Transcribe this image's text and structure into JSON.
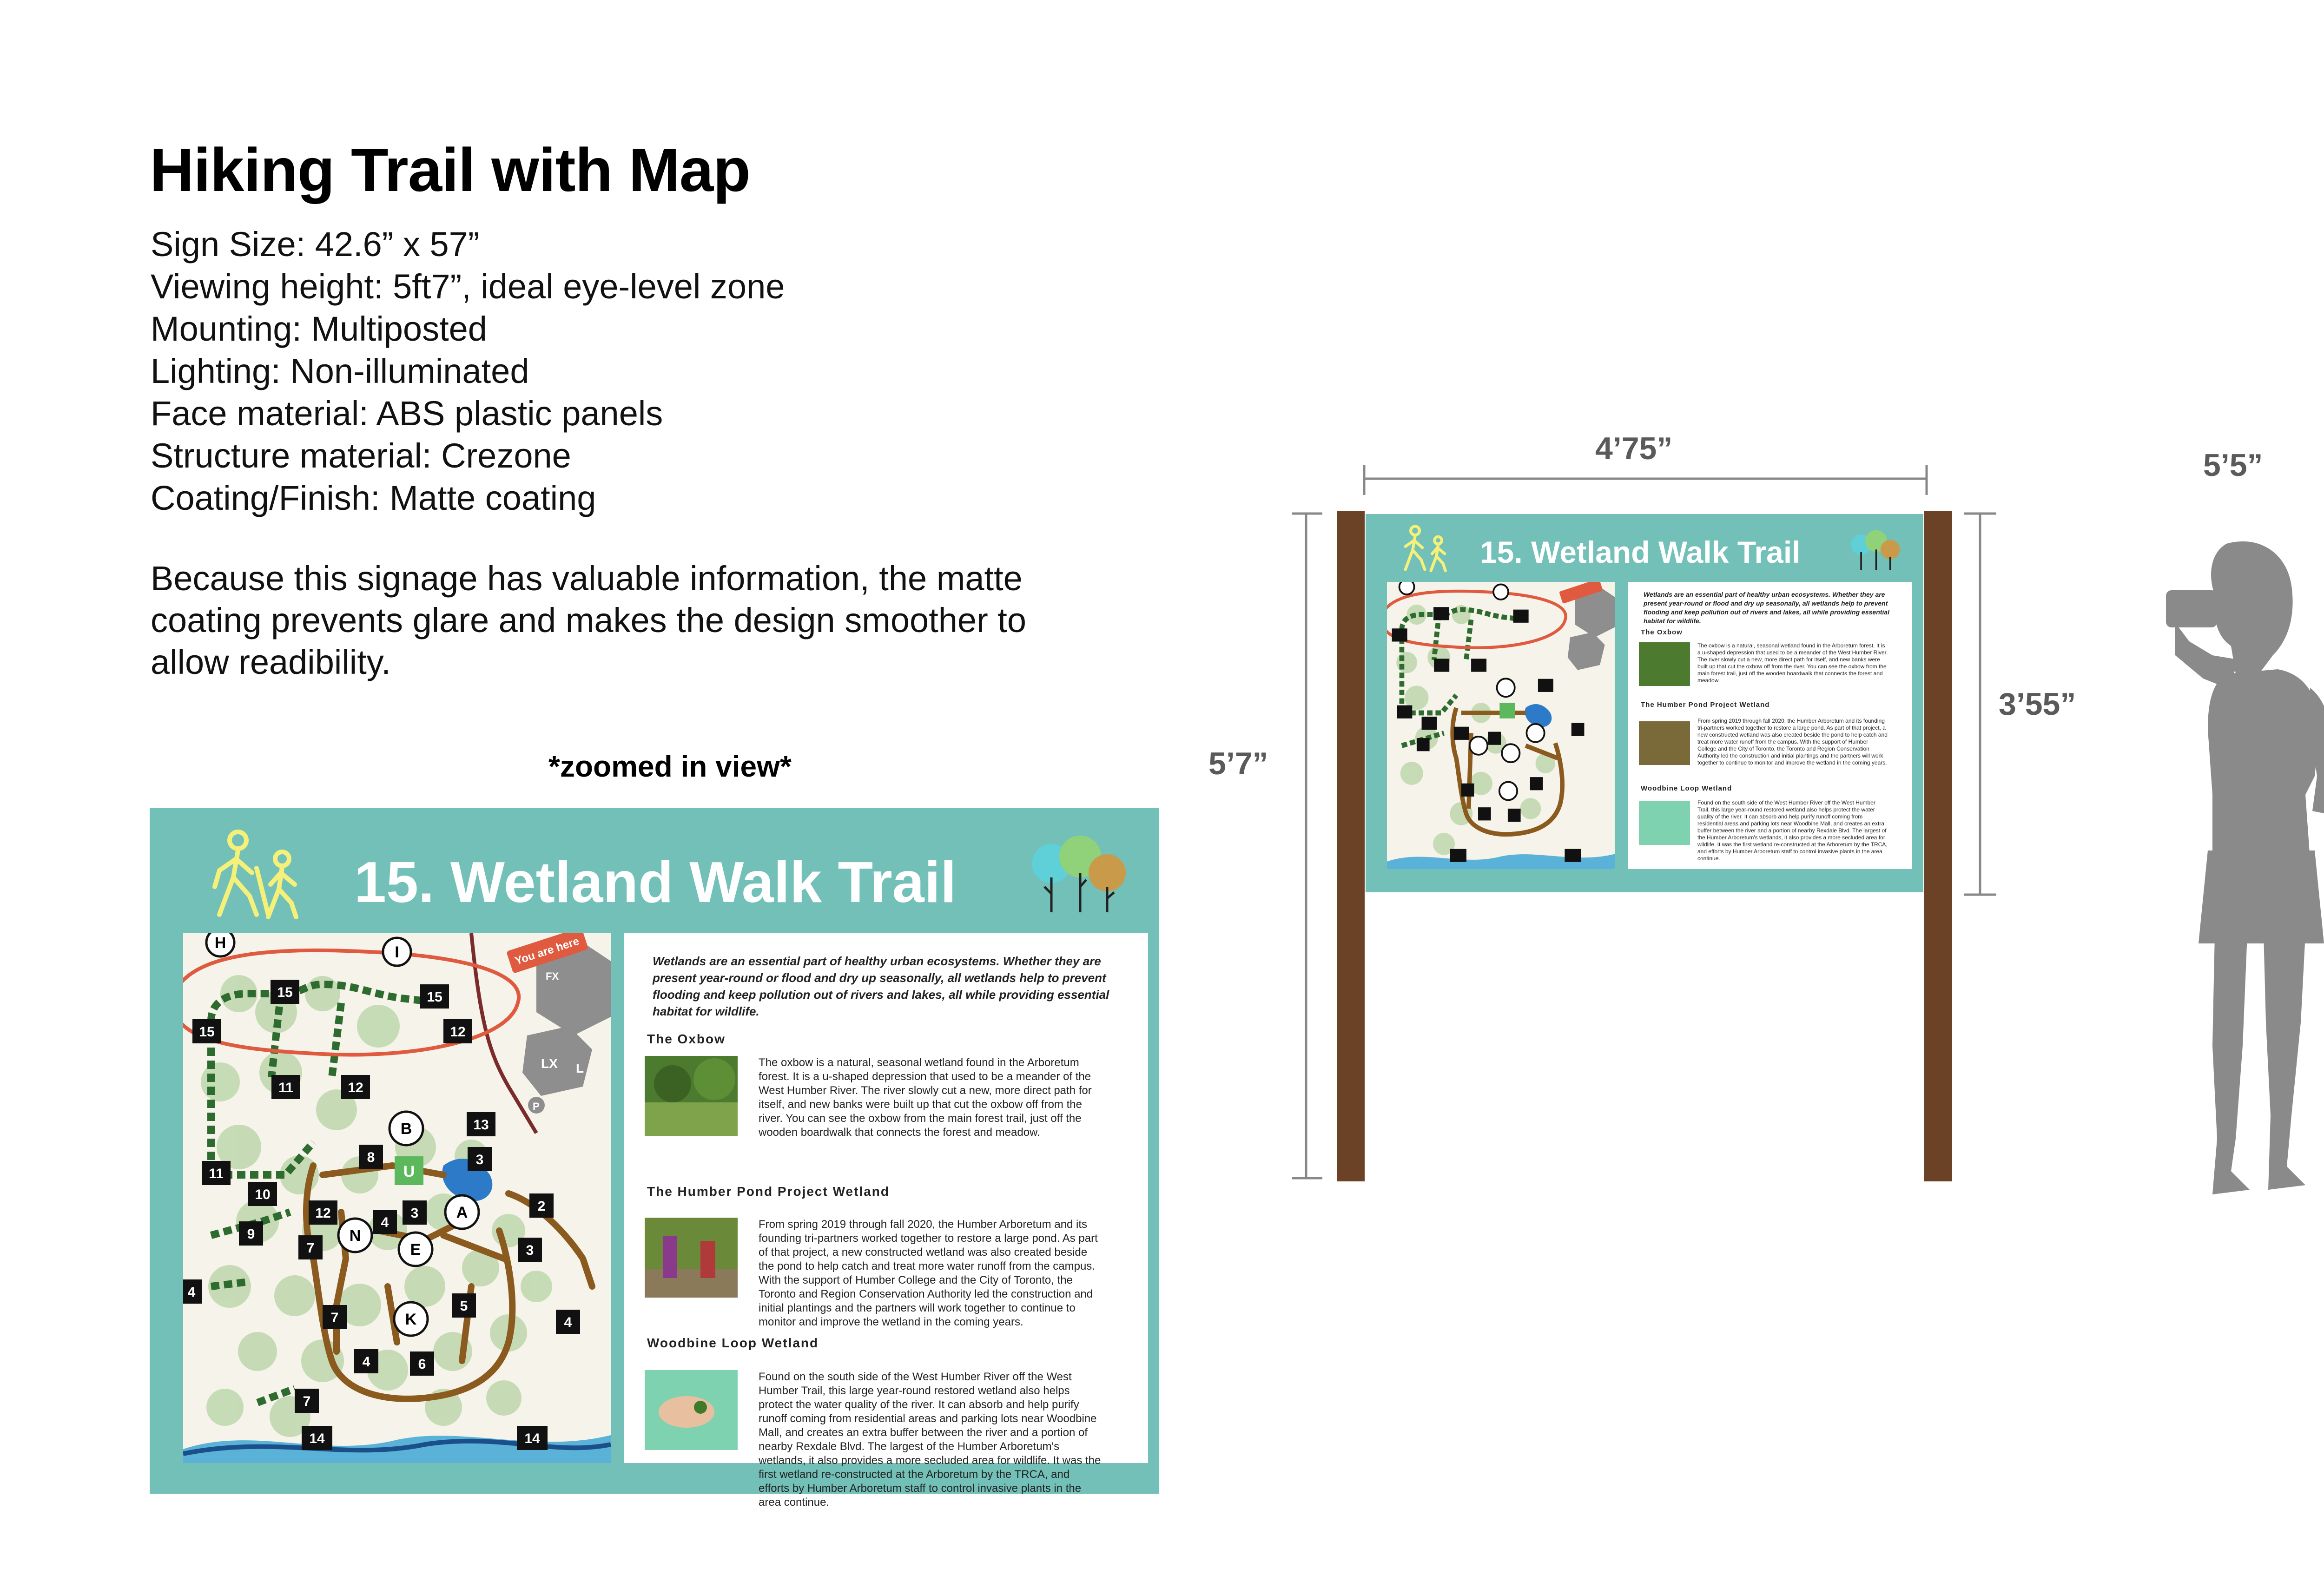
{
  "spec": {
    "title": "Hiking Trail with Map",
    "lines": [
      "Sign Size: 42.6” x 57”",
      "Viewing height: 5ft7”, ideal eye-level zone",
      "Mounting: Multiposted",
      "Lighting:  Non-illuminated",
      "Face material: ABS plastic panels",
      "Structure material:  Crezone",
      "Coating/Finish: Matte coating"
    ],
    "paragraph": "Because this signage has valuable information, the matte coating prevents glare and makes the design smoother to allow readibility.",
    "zoom_label": "*zoomed in view*"
  },
  "sign": {
    "title": "15. Wetland Walk Trail",
    "you_are_here": "You are here",
    "intro": "Wetlands are an essential part of healthy urban ecosystems. Whether they are present year-round or flood and dry up seasonally, all wetlands help to prevent flooding and keep pollution out of rivers and lakes, all while providing essential habitat for wildlife.",
    "sections": [
      {
        "heading": "The Oxbow",
        "body": "The oxbow is a natural, seasonal wetland found in the Arboretum forest. It is a u-shaped depression that used to be a meander of the West Humber River. The river slowly cut a new, more direct path for itself, and new banks were built up that cut the oxbow off from the river. You can see the oxbow from the main forest trail, just off the wooden boardwalk that connects the forest and meadow."
      },
      {
        "heading": "The Humber Pond Project Wetland",
        "body": "From spring 2019 through fall 2020, the Humber Arboretum and its founding tri-partners worked together to restore a large pond. As part of that project, a new constructed wetland was also created beside the pond to help catch and treat more water runoff from the campus. With the support of Humber College and the City of Toronto, the Toronto and Region Conservation Authority led the construction and initial plantings and the partners will work together to continue to monitor and improve the wetland in the coming years."
      },
      {
        "heading": "Woodbine Loop Wetland",
        "body": "Found on the south side of the West Humber River off the West Humber Trail, this large year-round restored wetland also helps protect the water quality of the river. It can absorb and help purify runoff coming from residential areas and parking lots near Woodbine Mall, and creates an extra buffer between the river and a portion of nearby Rexdale Blvd. The largest of the Humber Arboretum's wetlands, it also provides a more secluded area for wildlife. It was the first wetland re-constructed at the Arboretum by the TRCA, and efforts by Humber Arboretum staff to control invasive plants in the area continue."
      }
    ],
    "map_labels": {
      "circles": [
        "H",
        "I",
        "B",
        "N",
        "E",
        "A",
        "K"
      ],
      "square_u": "U",
      "buildings": [
        "FX",
        "LX",
        "L",
        "P"
      ],
      "trail_numbers": [
        "15",
        "15",
        "15",
        "12",
        "11",
        "12",
        "13",
        "11",
        "8",
        "3",
        "10",
        "12",
        "4",
        "3",
        "2",
        "9",
        "7",
        "3",
        "4",
        "7",
        "5",
        "4",
        "4",
        "6",
        "7",
        "14",
        "14"
      ]
    }
  },
  "dimensions": {
    "width": "4’75”",
    "height": "5’7”",
    "panel_height": "3’55”",
    "person_height": "5’5”"
  },
  "colors": {
    "panel_teal": "#72c0b8",
    "post_brown": "#6b4226",
    "trail_green": "#2e6b2e",
    "path_brown": "#8a5a1e",
    "you_are_here_red": "#e05a40",
    "silhouette_grey": "#8a8a8a",
    "hiker_yellow": "#f5f07a"
  },
  "icons": [
    "hikers-icon",
    "trees-icon",
    "person-silhouette-icon"
  ]
}
